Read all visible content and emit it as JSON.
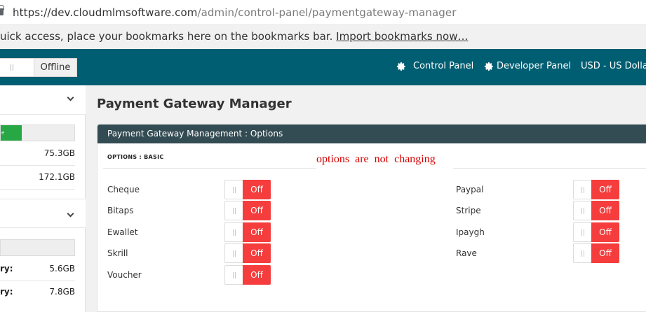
{
  "browser": {
    "url_host": "https://dev.cloudmlmsoftware.com",
    "url_path": "/admin/control-panel/paymentgateway-manager",
    "bookmarks_text": "uick access, place your bookmarks here on the bookmarks bar.",
    "bookmarks_link": "Import bookmarks now…"
  },
  "header": {
    "status_toggle_label": "Offline",
    "nav": [
      {
        "label": "Control Panel",
        "icon": "gear-icon"
      },
      {
        "label": "Developer Panel",
        "icon": "gear-icon"
      },
      {
        "label": "USD - US Dollar"
      }
    ],
    "bg_color": "#005e72"
  },
  "sidebar": {
    "bar1_label": "e",
    "rows1": [
      {
        "label": "",
        "value": "75.3GB"
      },
      {
        "label": "",
        "value": "172.1GB"
      }
    ],
    "rows2": [
      {
        "label": "ry:",
        "value": "5.6GB"
      },
      {
        "label": "ry:",
        "value": "7.8GB"
      }
    ]
  },
  "main": {
    "title": "Payment Gateway Manager",
    "panel_title": "Payment Gateway Management : Options",
    "options_label": "OPTIONS : BASIC",
    "annotation": "options are not changing",
    "left_options": [
      {
        "label": "Cheque",
        "state": "Off"
      },
      {
        "label": "Bitaps",
        "state": "Off"
      },
      {
        "label": "Ewallet",
        "state": "Off"
      },
      {
        "label": "Skrill",
        "state": "Off"
      },
      {
        "label": "Voucher",
        "state": "Off"
      }
    ],
    "right_options": [
      {
        "label": "Paypal",
        "state": "Off"
      },
      {
        "label": "Stripe",
        "state": "Off"
      },
      {
        "label": "Ipaygh",
        "state": "Off"
      },
      {
        "label": "Rave",
        "state": "Off"
      }
    ],
    "off_color": "#f53d3d"
  }
}
